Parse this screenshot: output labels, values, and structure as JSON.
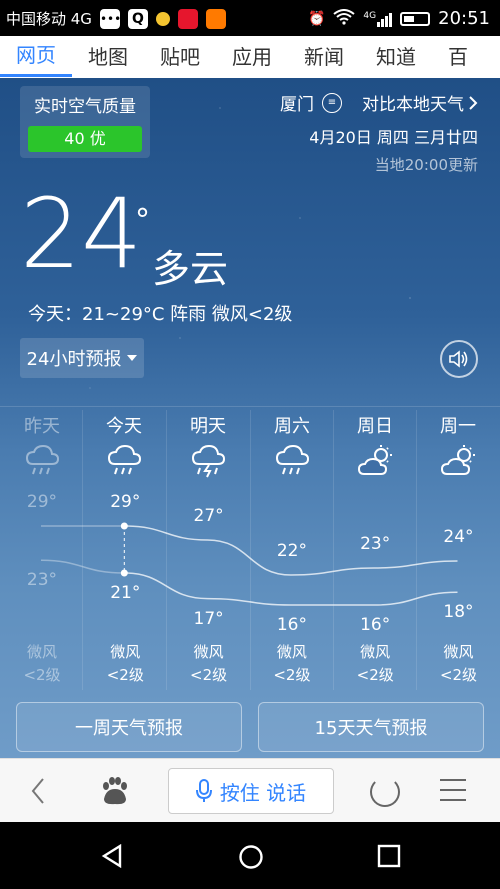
{
  "status_bar": {
    "carrier": "中国移动 4G",
    "network": "4G",
    "time": "20:51"
  },
  "nav_tabs": [
    "网页",
    "地图",
    "贴吧",
    "应用",
    "新闻",
    "知道",
    "百"
  ],
  "aqi": {
    "title": "实时空气质量",
    "value": "40 优",
    "color": "#2bc52b"
  },
  "location": {
    "city": "厦门",
    "compare_label": "对比本地天气",
    "date": "4月20日 周四 三月廿四",
    "updated": "当地20:00更新"
  },
  "current": {
    "temp": "24",
    "degree": "°",
    "condition": "多云",
    "today_summary": "今天：21~29°C  阵雨  微风<2级"
  },
  "forecast_toggle": "24小时预报",
  "days": [
    {
      "name": "昨天",
      "icon": "cloud-rain-icon",
      "high": 29,
      "low": 23,
      "high_label": "29°",
      "low_label": "23°",
      "wind": "微风",
      "level": "<2级"
    },
    {
      "name": "今天",
      "icon": "cloud-rain-icon",
      "high": 29,
      "low": 21,
      "high_label": "29°",
      "low_label": "21°",
      "wind": "微风",
      "level": "<2级"
    },
    {
      "name": "明天",
      "icon": "thunder-rain-icon",
      "high": 27,
      "low": 17,
      "high_label": "27°",
      "low_label": "17°",
      "wind": "微风",
      "level": "<2级"
    },
    {
      "name": "周六",
      "icon": "cloud-rain-icon",
      "high": 22,
      "low": 16,
      "high_label": "22°",
      "low_label": "16°",
      "wind": "微风",
      "level": "<2级"
    },
    {
      "name": "周日",
      "icon": "sun-cloud-icon",
      "high": 23,
      "low": 16,
      "high_label": "23°",
      "low_label": "16°",
      "wind": "微风",
      "level": "<2级"
    },
    {
      "name": "周一",
      "icon": "sun-cloud-icon",
      "high": 24,
      "low": 18,
      "high_label": "24°",
      "low_label": "18°",
      "wind": "微风",
      "level": "<2级"
    }
  ],
  "buttons": {
    "week": "一周天气预报",
    "fifteen": "15天天气预报"
  },
  "toolbar": {
    "voice_label": "按住 说话"
  }
}
